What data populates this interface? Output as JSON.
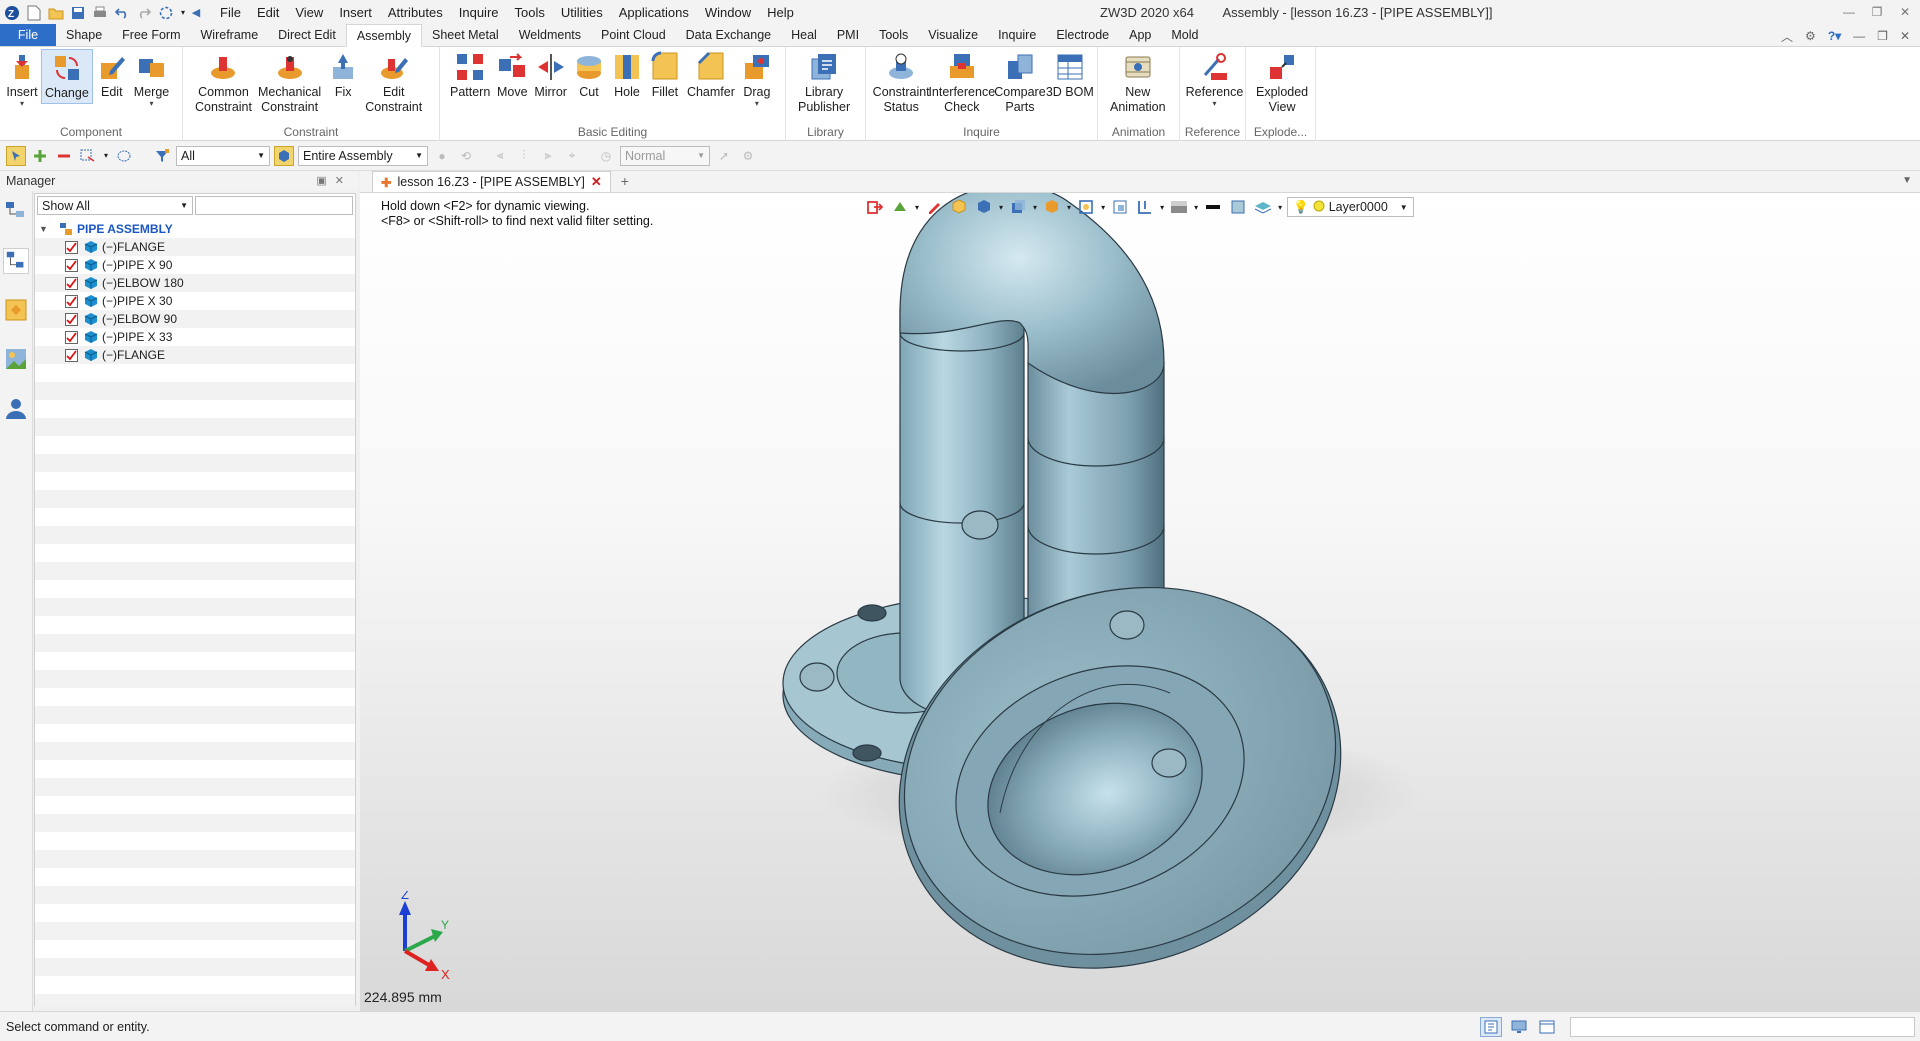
{
  "titlebar": {
    "app_name": "ZW3D 2020 x64",
    "document_title": "Assembly - [lesson 16.Z3 - [PIPE ASSEMBLY]]",
    "menu": [
      "File",
      "Edit",
      "View",
      "Insert",
      "Attributes",
      "Inquire",
      "Tools",
      "Utilities",
      "Applications",
      "Window",
      "Help"
    ]
  },
  "ribbon_tabs": [
    "File",
    "Shape",
    "Free Form",
    "Wireframe",
    "Direct Edit",
    "Assembly",
    "Sheet Metal",
    "Weldments",
    "Point Cloud",
    "Data Exchange",
    "Heal",
    "PMI",
    "Tools",
    "Visualize",
    "Inquire",
    "Electrode",
    "App",
    "Mold"
  ],
  "active_ribbon_tab": "Assembly",
  "ribbon_groups": {
    "component": {
      "label": "Component",
      "buttons": [
        "Insert",
        "Change",
        "Edit",
        "Merge"
      ]
    },
    "constraint": {
      "label": "Constraint",
      "buttons": [
        [
          "Common",
          "Constraint"
        ],
        [
          "Mechanical",
          "Constraint"
        ],
        "Fix",
        [
          "Edit",
          "Constraint"
        ]
      ]
    },
    "basic_editing": {
      "label": "Basic Editing",
      "buttons": [
        "Pattern",
        "Move",
        "Mirror",
        "Cut",
        "Hole",
        "Fillet",
        "Chamfer",
        "Drag"
      ]
    },
    "library": {
      "label": "Library",
      "buttons": [
        [
          "Library",
          "Publisher"
        ]
      ]
    },
    "inquire": {
      "label": "Inquire",
      "buttons": [
        [
          "Constraint",
          "Status"
        ],
        [
          "Interference",
          "Check"
        ],
        [
          "Compare",
          "Parts"
        ],
        "3D BOM"
      ]
    },
    "animation": {
      "label": "Animation",
      "buttons": [
        [
          "New",
          "Animation"
        ]
      ]
    },
    "reference": {
      "label": "Reference",
      "buttons": [
        "Reference"
      ]
    },
    "explode": {
      "label": "Explode...",
      "buttons": [
        [
          "Exploded",
          "View"
        ]
      ]
    }
  },
  "toolbar": {
    "filter_value": "All",
    "scope_value": "Entire Assembly",
    "mode_value": "Normal"
  },
  "manager": {
    "title": "Manager",
    "show_filter": "Show All",
    "search_placeholder": "",
    "root": "PIPE ASSEMBLY",
    "items": [
      "(−)FLANGE",
      "(−)PIPE X 90",
      "(−)ELBOW 180",
      "(−)PIPE X 30",
      "(−)ELBOW 90",
      "(−)PIPE X 33",
      "(−)FLANGE"
    ]
  },
  "doc_tab": {
    "label": "lesson 16.Z3 - [PIPE ASSEMBLY]"
  },
  "viewport": {
    "hint_line1": "Hold down <F2> for dynamic viewing.",
    "hint_line2": "<F8> or <Shift-roll> to find next valid filter setting.",
    "layer": "Layer0000",
    "scale": "224.895 mm",
    "triad": {
      "x": "X",
      "y": "Y",
      "z": "Z"
    }
  },
  "statusbar": {
    "text": "Select command or entity."
  },
  "colors": {
    "accent": "#2d6ec8",
    "model_fill": "#a9cad6",
    "model_edge": "#2a3a44"
  }
}
